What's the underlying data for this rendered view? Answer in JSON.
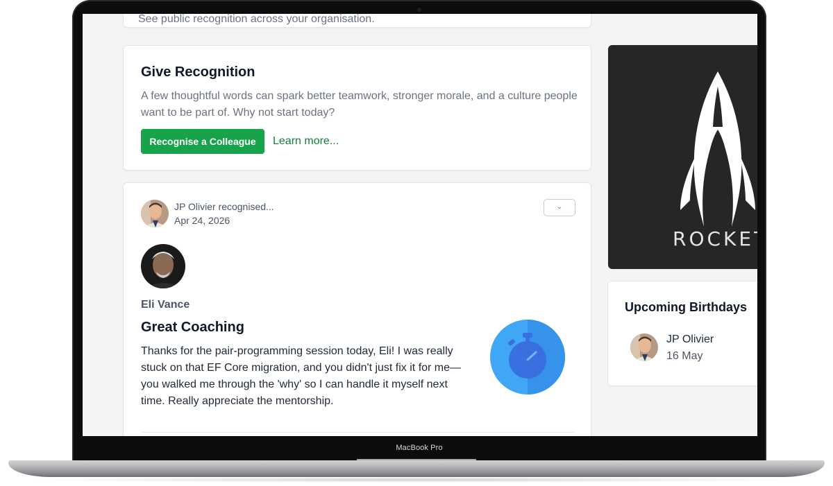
{
  "device": {
    "label": "MacBook Pro"
  },
  "top_card": {
    "subtitle": "See public recognition across your organisation."
  },
  "give_recognition": {
    "title": "Give Recognition",
    "description": "A few thoughtful words can spark better teamwork, stronger morale, and a culture people want to be part of. Why not start today?",
    "primary_button": "Recognise a Colleague",
    "learn_more": "Learn more..."
  },
  "post": {
    "poster_line": "JP Olivier recognised...",
    "date": "Apr 24, 2026",
    "dropdown_icon": "chevron-down-icon",
    "recipient": "Eli Vance",
    "award_title": "Great Coaching",
    "message": "Thanks for the pair-programming session today, Eli! I was really stuck on that EF Core migration, and you didn't just fix it for me—you walked me through the 'why' so I can handle it myself next time. Really appreciate the mentorship.",
    "badge_icon": "stopwatch-icon",
    "badge_color": "#3b9cf0"
  },
  "sidebar": {
    "banner": {
      "logo_text": "ROCKET",
      "icon": "rocket-icon",
      "background": "#262626"
    },
    "birthdays": {
      "title": "Upcoming Birthdays",
      "items": [
        {
          "name": "JP Olivier",
          "date": "16 May"
        }
      ]
    }
  },
  "colors": {
    "accent": "#16a34a",
    "link": "#15803d",
    "page_bg": "#f3f4f6"
  }
}
